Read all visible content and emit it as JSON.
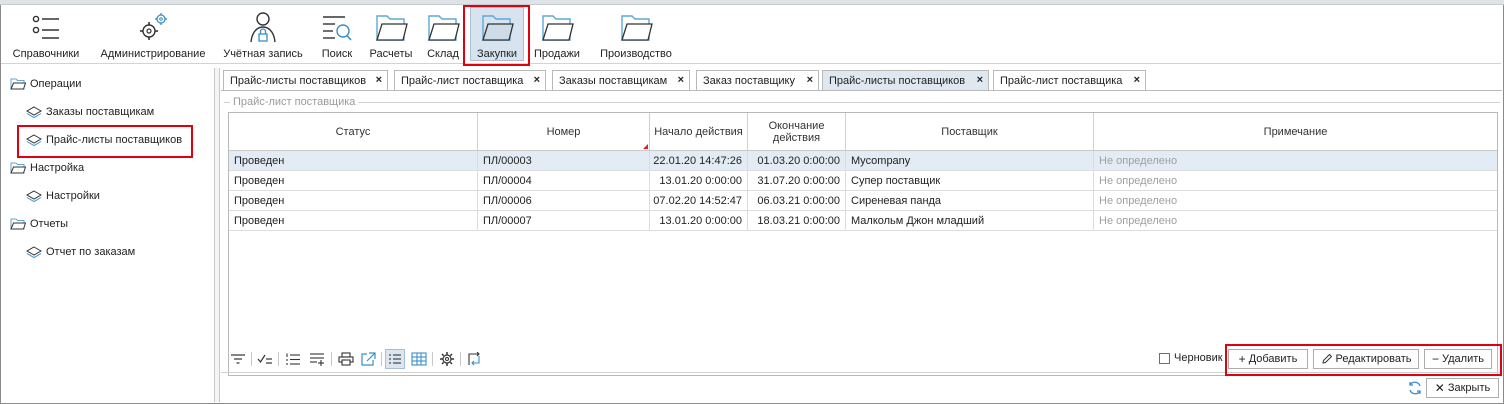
{
  "toolbar": {
    "items": [
      {
        "label": "Справочники",
        "icon": "list-icon"
      },
      {
        "label": "Администрирование",
        "icon": "gears-icon"
      },
      {
        "label": "Учётная запись",
        "icon": "user-lock-icon"
      },
      {
        "label": "Поиск",
        "icon": "search-list-icon"
      },
      {
        "label": "Расчеты",
        "icon": "folder-icon"
      },
      {
        "label": "Склад",
        "icon": "folder-icon"
      },
      {
        "label": "Закупки",
        "icon": "folder-icon"
      },
      {
        "label": "Продажи",
        "icon": "folder-icon"
      },
      {
        "label": "Производство",
        "icon": "folder-icon"
      }
    ],
    "selected": "Закупки"
  },
  "tree": {
    "groups": [
      {
        "label": "Операции",
        "items": [
          "Заказы поставщикам",
          "Прайс-листы поставщиков"
        ]
      },
      {
        "label": "Настройка",
        "items": [
          "Настройки"
        ]
      },
      {
        "label": "Отчеты",
        "items": [
          "Отчет по заказам"
        ]
      }
    ]
  },
  "tabs": [
    {
      "label": "Прайс-листы поставщиков"
    },
    {
      "label": "Прайс-лист поставщика"
    },
    {
      "label": "Заказы поставщикам"
    },
    {
      "label": "Заказ поставщику"
    },
    {
      "label": "Прайс-листы поставщиков"
    },
    {
      "label": "Прайс-лист поставщика"
    }
  ],
  "close_glyph": "×",
  "group_title": "Прайс-лист поставщика",
  "grid": {
    "columns": [
      "Статус",
      "Номер",
      "Начало действия",
      "Окончание действия",
      "Поставщик",
      "Примечание"
    ],
    "rows": [
      [
        "Проведен",
        "ПЛ/00003",
        "22.01.20 14:47:26",
        "01.03.20 0:00:00",
        "Mycompany",
        "Не определено"
      ],
      [
        "Проведен",
        "ПЛ/00004",
        "13.01.20 0:00:00",
        "31.07.20 0:00:00",
        "Супер поставщик",
        "Не определено"
      ],
      [
        "Проведен",
        "ПЛ/00006",
        "07.02.20 14:52:47",
        "06.03.21 0:00:00",
        "Сиреневая панда",
        "Не определено"
      ],
      [
        "Проведен",
        "ПЛ/00007",
        "13.01.20 0:00:00",
        "18.03.21 0:00:00",
        "Малкольм Джон младший",
        "Не определено"
      ]
    ]
  },
  "bottom": {
    "draft_label": "Черновик",
    "add_label": "Добавить",
    "edit_label": "Редактировать",
    "delete_label": "Удалить",
    "close_label": "Закрыть"
  },
  "colors": {
    "accent": "#e0000f",
    "selection": "#e3ecf5",
    "folder": "#5fa8d6"
  }
}
